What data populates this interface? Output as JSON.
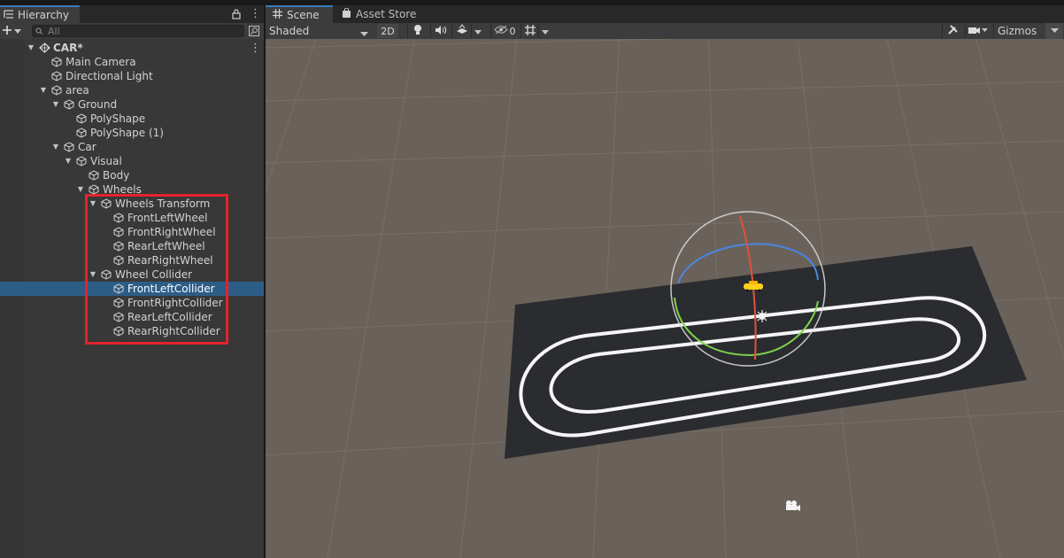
{
  "hierarchy": {
    "tab_label": "Hierarchy",
    "search_placeholder": "All",
    "items": [
      {
        "label": "CAR*",
        "depth": 0,
        "expanded": true,
        "kind": "scene"
      },
      {
        "label": "Main Camera",
        "depth": 1
      },
      {
        "label": "Directional Light",
        "depth": 1
      },
      {
        "label": "area",
        "depth": 1,
        "expanded": true
      },
      {
        "label": "Ground",
        "depth": 2,
        "expanded": true
      },
      {
        "label": "PolyShape",
        "depth": 3
      },
      {
        "label": "PolyShape (1)",
        "depth": 3
      },
      {
        "label": "Car",
        "depth": 2,
        "expanded": true
      },
      {
        "label": "Visual",
        "depth": 3,
        "expanded": true
      },
      {
        "label": "Body",
        "depth": 4
      },
      {
        "label": "Wheels",
        "depth": 4,
        "expanded": true
      },
      {
        "label": "Wheels Transform",
        "depth": 5,
        "expanded": true
      },
      {
        "label": "FrontLeftWheel",
        "depth": 6
      },
      {
        "label": "FrontRightWheel",
        "depth": 6
      },
      {
        "label": "RearLeftWheel",
        "depth": 6
      },
      {
        "label": "RearRightWheel",
        "depth": 6
      },
      {
        "label": "Wheel Collider",
        "depth": 5,
        "expanded": true
      },
      {
        "label": "FrontLeftCollider",
        "depth": 6,
        "selected": true
      },
      {
        "label": "FrontRightCollider",
        "depth": 6
      },
      {
        "label": "RearLeftCollider",
        "depth": 6
      },
      {
        "label": "RearRightCollider",
        "depth": 6
      }
    ]
  },
  "scene": {
    "tabs": {
      "scene": "Scene",
      "asset_store": "Asset Store"
    },
    "toolbar": {
      "shading_mode": "Shaded",
      "mode_2d": "2D",
      "hidden_count": "0",
      "gizmos_label": "Gizmos"
    }
  },
  "colors": {
    "selection": "#2c5d87",
    "highlight_box": "#e3232b",
    "viewport_bg": "#6a625a",
    "track_plane": "#2a2c30",
    "gizmo_x": "#e0533a",
    "gizmo_y": "#7fd34a",
    "gizmo_z": "#4a86e0"
  },
  "icons": [
    "hierarchy-icon",
    "lock-icon",
    "kebab-menu-icon",
    "plus-icon",
    "search-icon",
    "search-settings-icon",
    "cube-icon",
    "unity-scene-icon",
    "scene-grid-icon",
    "store-bag-icon",
    "lightbulb-icon",
    "audio-icon",
    "effects-icon",
    "visibility-icon",
    "grid-snap-icon",
    "tools-icon",
    "camera-icon",
    "sun-icon",
    "movie-camera-icon"
  ]
}
